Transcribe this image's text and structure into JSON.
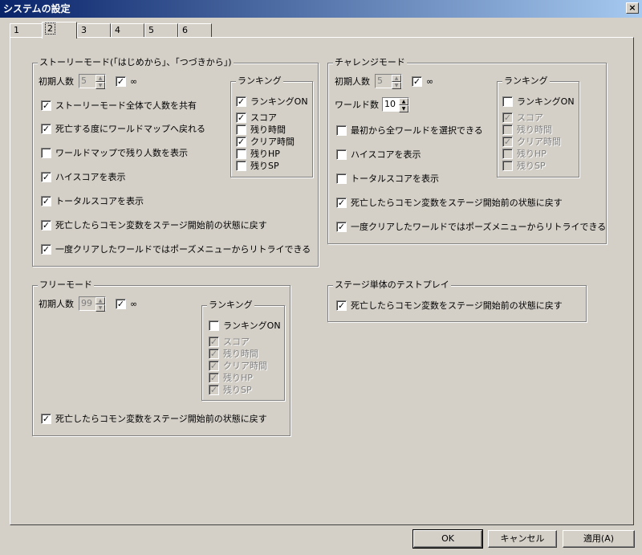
{
  "window": {
    "title": "システムの設定",
    "close_label": "×"
  },
  "tabs": [
    {
      "label": "1"
    },
    {
      "label": "2"
    },
    {
      "label": "3"
    },
    {
      "label": "4"
    },
    {
      "label": "5"
    },
    {
      "label": "6"
    }
  ],
  "story": {
    "legend": "ストーリーモード(「はじめから」、「つづきから」)",
    "initial_lives_label": "初期人数",
    "initial_lives_value": "5",
    "infinite_label": "∞",
    "options": [
      {
        "label": "ストーリーモード全体で人数を共有",
        "checked": true
      },
      {
        "label": "死亡する度にワールドマップへ戻れる",
        "checked": true
      },
      {
        "label": "ワールドマップで残り人数を表示",
        "checked": false
      },
      {
        "label": "ハイスコアを表示",
        "checked": true
      },
      {
        "label": "トータルスコアを表示",
        "checked": true
      },
      {
        "label": "死亡したらコモン変数をステージ開始前の状態に戻す",
        "checked": true
      },
      {
        "label": "一度クリアしたワールドではポーズメニューからリトライできる",
        "checked": true
      }
    ],
    "ranking": {
      "legend": "ランキング",
      "on_label": "ランキングON",
      "items": [
        {
          "label": "スコア"
        },
        {
          "label": "残り時間"
        },
        {
          "label": "クリア時間"
        },
        {
          "label": "残りHP"
        },
        {
          "label": "残りSP"
        }
      ]
    }
  },
  "challenge": {
    "legend": "チャレンジモード",
    "initial_lives_label": "初期人数",
    "initial_lives_value": "5",
    "infinite_label": "∞",
    "world_count_label": "ワールド数",
    "world_count_value": "10",
    "options": [
      {
        "label": "最初から全ワールドを選択できる",
        "checked": false
      },
      {
        "label": "ハイスコアを表示",
        "checked": false
      },
      {
        "label": "トータルスコアを表示",
        "checked": false
      },
      {
        "label": "死亡したらコモン変数をステージ開始前の状態に戻す",
        "checked": true
      },
      {
        "label": "一度クリアしたワールドではポーズメニューからリトライできる",
        "checked": true
      }
    ],
    "ranking": {
      "legend": "ランキング",
      "on_label": "ランキングON",
      "items": [
        {
          "label": "スコア"
        },
        {
          "label": "残り時間"
        },
        {
          "label": "クリア時間"
        },
        {
          "label": "残りHP"
        },
        {
          "label": "残りSP"
        }
      ]
    }
  },
  "free": {
    "legend": "フリーモード",
    "initial_lives_label": "初期人数",
    "initial_lives_value": "99",
    "infinite_label": "∞",
    "option": {
      "label": "死亡したらコモン変数をステージ開始前の状態に戻す"
    },
    "ranking": {
      "legend": "ランキング",
      "on_label": "ランキングON",
      "items": [
        {
          "label": "スコア"
        },
        {
          "label": "残り時間"
        },
        {
          "label": "クリア時間"
        },
        {
          "label": "残りHP"
        },
        {
          "label": "残りSP"
        }
      ]
    }
  },
  "stage_test": {
    "legend": "ステージ単体のテストプレイ",
    "option": {
      "label": "死亡したらコモン変数をステージ開始前の状態に戻す"
    }
  },
  "buttons": {
    "ok": "OK",
    "cancel": "キャンセル",
    "apply": "適用(A)"
  },
  "check_mark": "✓"
}
